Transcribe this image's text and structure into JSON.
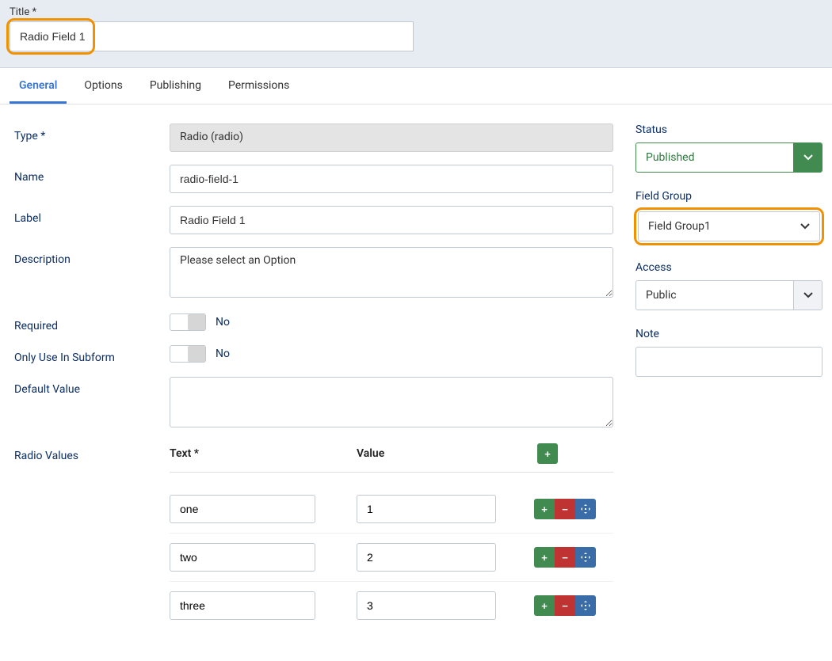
{
  "header": {
    "title_label": "Title *",
    "title_value": "Radio Field 1"
  },
  "tabs": [
    {
      "id": "general",
      "label": "General",
      "active": true
    },
    {
      "id": "options",
      "label": "Options",
      "active": false
    },
    {
      "id": "publishing",
      "label": "Publishing",
      "active": false
    },
    {
      "id": "permissions",
      "label": "Permissions",
      "active": false
    }
  ],
  "general": {
    "type_label": "Type *",
    "type_value": "Radio (radio)",
    "name_label": "Name",
    "name_value": "radio-field-1",
    "label_label": "Label",
    "label_value": "Radio Field 1",
    "description_label": "Description",
    "description_value": "Please select an Option",
    "required_label": "Required",
    "required_text": "No",
    "subform_label": "Only Use In Subform",
    "subform_text": "No",
    "default_label": "Default Value",
    "default_value": "",
    "radiovalues_label": "Radio Values",
    "rv_col_text": "Text *",
    "rv_col_value": "Value",
    "rows": [
      {
        "text": "one",
        "value": "1"
      },
      {
        "text": "two",
        "value": "2"
      },
      {
        "text": "three",
        "value": "3"
      }
    ]
  },
  "sidebar": {
    "status_label": "Status",
    "status_value": "Published",
    "fieldgroup_label": "Field Group",
    "fieldgroup_value": "Field Group1",
    "access_label": "Access",
    "access_value": "Public",
    "note_label": "Note",
    "note_value": ""
  }
}
